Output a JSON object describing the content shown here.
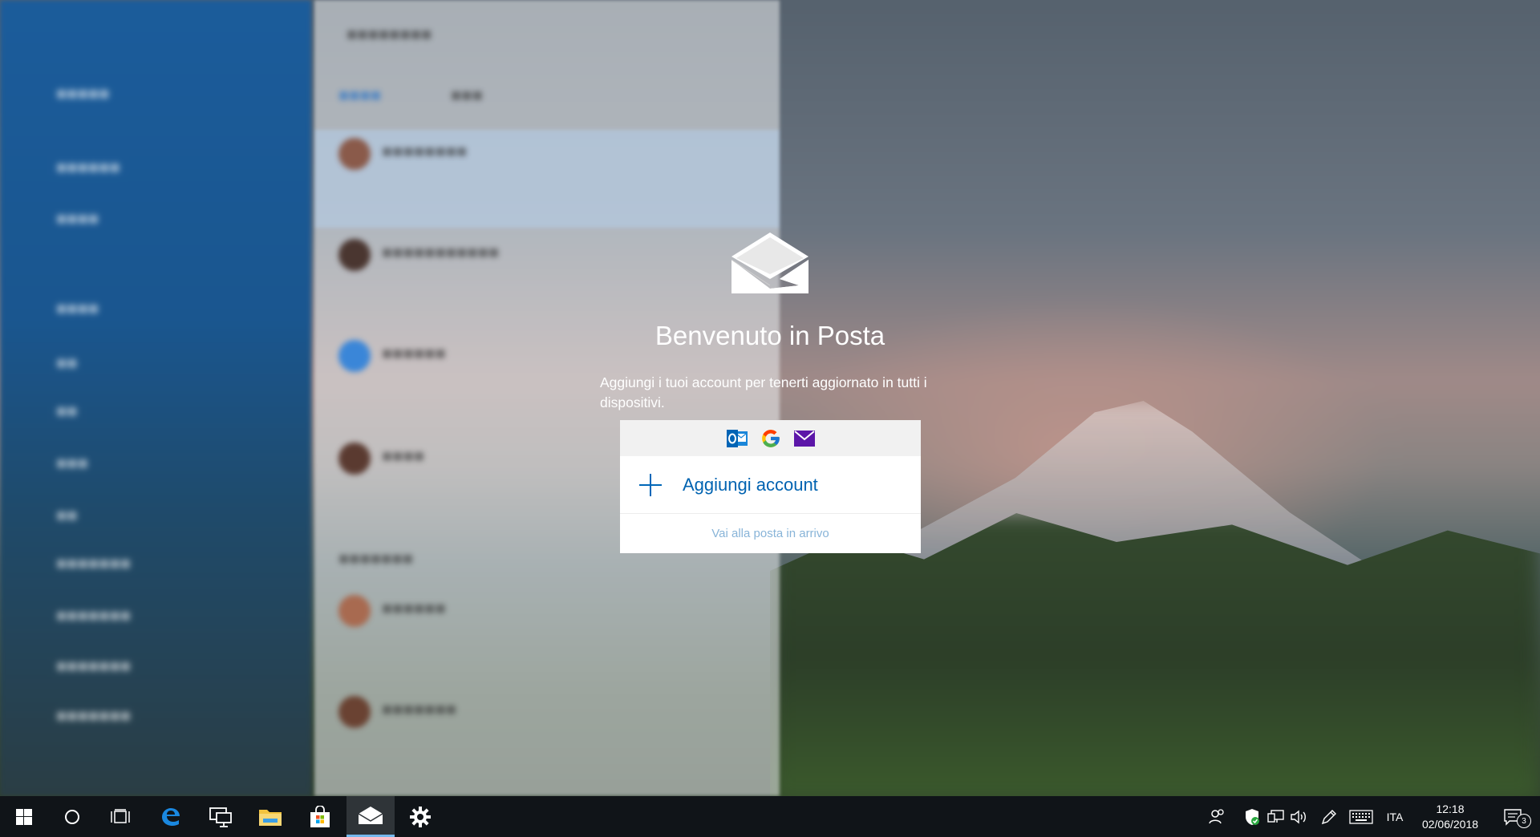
{
  "welcome": {
    "title": "Benvenuto in Posta",
    "subtitle": "Aggiungi i tuoi account per tenerti aggiornato in tutti i dispositivi.",
    "providers": [
      "outlook-icon",
      "google-icon",
      "mail-icon"
    ],
    "add_account_label": "Aggiungi account",
    "goto_inbox_label": "Vai alla posta in arrivo"
  },
  "taskbar": {
    "apps": [
      "start-icon",
      "cortana-icon",
      "task-view-icon",
      "edge-icon",
      "remote-desktop-icon",
      "file-explorer-icon",
      "store-icon",
      "mail-icon",
      "settings-icon"
    ],
    "active_app": "mail-icon",
    "tray": {
      "language": "ITA",
      "time": "12:18",
      "date": "02/06/2018",
      "notification_count": "3"
    }
  },
  "colors": {
    "accent": "#0063b1",
    "taskbar": "#101418",
    "active_underline": "#76b9ed"
  }
}
